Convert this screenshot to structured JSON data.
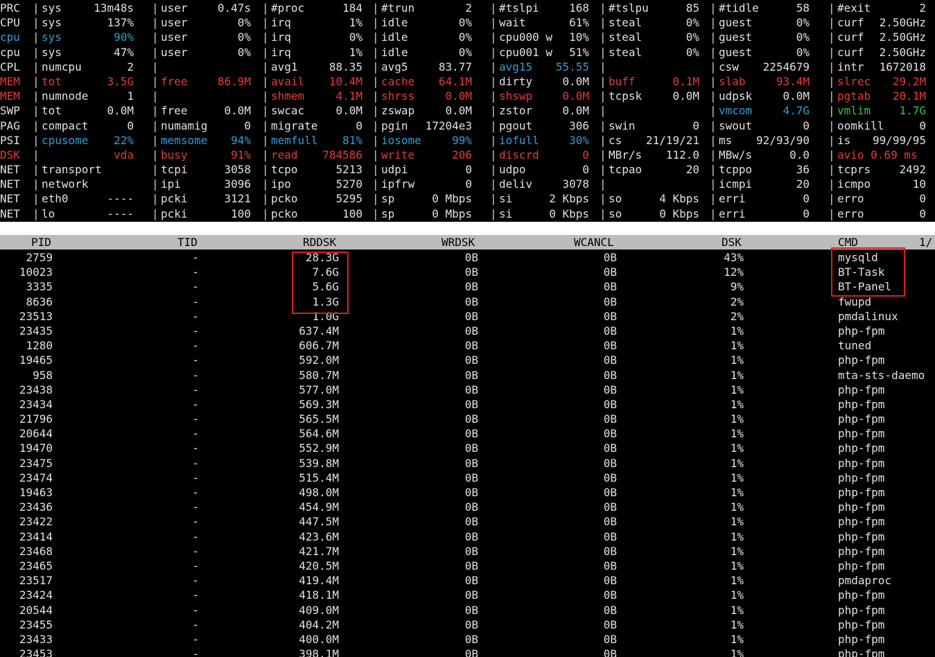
{
  "colors": {
    "white": "#e2e2e2",
    "red": "#e8393c",
    "blue": "#2e9fd6",
    "green": "#3ec43e",
    "header_bg": "#bcbcbc",
    "highlight_box": "#e11b1b"
  },
  "system_rows": [
    {
      "label": "PRC",
      "color": "white",
      "cells": [
        {
          "k": "sys",
          "v": "13m48s"
        },
        {
          "k": "user",
          "v": "0.47s"
        },
        {
          "k": "#proc",
          "v": "184"
        },
        {
          "k": "#trun",
          "v": "2"
        },
        {
          "k": "#tslpi",
          "v": "168"
        },
        {
          "k": "#tslpu",
          "v": "85"
        },
        {
          "k": "#tidle",
          "v": "58"
        },
        {
          "k": "#exit",
          "v": "2"
        }
      ]
    },
    {
      "label": "CPU",
      "color": "white",
      "cells": [
        {
          "k": "sys",
          "v": "137%"
        },
        {
          "k": "user",
          "v": "0%"
        },
        {
          "k": "irq",
          "v": "1%"
        },
        {
          "k": "idle",
          "v": "0%"
        },
        {
          "k": "wait",
          "v": "61%"
        },
        {
          "k": "steal",
          "v": "0%"
        },
        {
          "k": "guest",
          "v": "0%"
        },
        {
          "k": "curf",
          "v": "2.50GHz"
        }
      ]
    },
    {
      "label": "cpu",
      "color": "blue",
      "cells": [
        {
          "k": "sys",
          "v": "90%",
          "c": "blue"
        },
        {
          "k": "user",
          "v": "0%"
        },
        {
          "k": "irq",
          "v": "0%"
        },
        {
          "k": "idle",
          "v": "0%"
        },
        {
          "k": "cpu000 w",
          "v": "10%"
        },
        {
          "k": "steal",
          "v": "0%"
        },
        {
          "k": "guest",
          "v": "0%"
        },
        {
          "k": "curf",
          "v": "2.50GHz"
        }
      ]
    },
    {
      "label": "cpu",
      "color": "white",
      "cells": [
        {
          "k": "sys",
          "v": "47%"
        },
        {
          "k": "user",
          "v": "0%"
        },
        {
          "k": "irq",
          "v": "1%"
        },
        {
          "k": "idle",
          "v": "0%"
        },
        {
          "k": "cpu001 w",
          "v": "51%"
        },
        {
          "k": "steal",
          "v": "0%"
        },
        {
          "k": "guest",
          "v": "0%"
        },
        {
          "k": "curf",
          "v": "2.50GHz"
        }
      ]
    },
    {
      "label": "CPL",
      "color": "white",
      "cells": [
        {
          "k": "numcpu",
          "v": "2"
        },
        {
          "k": "",
          "v": ""
        },
        {
          "k": "avg1",
          "v": "88.35"
        },
        {
          "k": "avg5",
          "v": "83.77"
        },
        {
          "k": "avg15",
          "v": "55.55",
          "c": "blue"
        },
        {
          "k": "",
          "v": ""
        },
        {
          "k": "csw",
          "v": "2254679"
        },
        {
          "k": "intr",
          "v": "1672018"
        }
      ]
    },
    {
      "label": "MEM",
      "color": "red",
      "cells": [
        {
          "k": "tot",
          "v": "3.5G",
          "c": "red"
        },
        {
          "k": "free",
          "v": "86.9M",
          "c": "red"
        },
        {
          "k": "avail",
          "v": "10.4M",
          "c": "red"
        },
        {
          "k": "cache",
          "v": "64.1M",
          "c": "red"
        },
        {
          "k": "dirty",
          "v": "0.0M"
        },
        {
          "k": "buff",
          "v": "0.1M",
          "c": "red"
        },
        {
          "k": "slab",
          "v": "93.4M",
          "c": "red"
        },
        {
          "k": "slrec",
          "v": "29.2M",
          "c": "red"
        }
      ]
    },
    {
      "label": "MEM",
      "color": "red",
      "cells": [
        {
          "k": "numnode",
          "v": "1"
        },
        {
          "k": "",
          "v": ""
        },
        {
          "k": "shmem",
          "v": "4.1M",
          "c": "red"
        },
        {
          "k": "shrss",
          "v": "0.0M",
          "c": "red"
        },
        {
          "k": "shswp",
          "v": "0.0M",
          "c": "red"
        },
        {
          "k": "tcpsk",
          "v": "0.0M"
        },
        {
          "k": "udpsk",
          "v": "0.0M"
        },
        {
          "k": "pgtab",
          "v": "20.1M",
          "c": "red"
        }
      ]
    },
    {
      "label": "SWP",
      "color": "white",
      "cells": [
        {
          "k": "tot",
          "v": "0.0M"
        },
        {
          "k": "free",
          "v": "0.0M"
        },
        {
          "k": "swcac",
          "v": "0.0M"
        },
        {
          "k": "zswap",
          "v": "0.0M"
        },
        {
          "k": "zstor",
          "v": "0.0M"
        },
        {
          "k": "",
          "v": ""
        },
        {
          "k": "vmcom",
          "v": "4.7G",
          "c": "blue"
        },
        {
          "k": "vmlim",
          "v": "1.7G",
          "c": "green"
        }
      ]
    },
    {
      "label": "PAG",
      "color": "white",
      "cells": [
        {
          "k": "compact",
          "v": "0"
        },
        {
          "k": "numamig",
          "v": "0"
        },
        {
          "k": "migrate",
          "v": "0"
        },
        {
          "k": "pgin",
          "v": "17204e3"
        },
        {
          "k": "pgout",
          "v": "306"
        },
        {
          "k": "swin",
          "v": "0"
        },
        {
          "k": "swout",
          "v": "0"
        },
        {
          "k": "oomkill",
          "v": "0"
        }
      ]
    },
    {
      "label": "PSI",
      "color": "white",
      "cells": [
        {
          "k": "cpusome",
          "v": "22%",
          "c": "blue"
        },
        {
          "k": "memsome",
          "v": "94%",
          "c": "blue"
        },
        {
          "k": "memfull",
          "v": "81%",
          "c": "blue"
        },
        {
          "k": "iosome",
          "v": "99%",
          "c": "blue"
        },
        {
          "k": "iofull",
          "v": "30%",
          "c": "blue"
        },
        {
          "k": "cs",
          "v": "21/19/21"
        },
        {
          "k": "ms",
          "v": "92/93/90"
        },
        {
          "k": "is",
          "v": "99/99/95"
        }
      ]
    },
    {
      "label": "DSK",
      "color": "red",
      "cells": [
        {
          "k": "",
          "v": "vda",
          "c": "red"
        },
        {
          "k": "busy",
          "v": "91%",
          "c": "red"
        },
        {
          "k": "read",
          "v": "784586",
          "c": "red"
        },
        {
          "k": "write",
          "v": "206",
          "c": "red"
        },
        {
          "k": "discrd",
          "v": "0",
          "c": "red"
        },
        {
          "k": "MBr/s",
          "v": "112.0"
        },
        {
          "k": "MBw/s",
          "v": "0.0"
        },
        {
          "k": "avio 0.69 ms",
          "v": "",
          "c": "red"
        }
      ]
    },
    {
      "label": "NET",
      "color": "white",
      "cells": [
        {
          "k": "transport",
          "v": ""
        },
        {
          "k": "tcpi",
          "v": "3058"
        },
        {
          "k": "tcpo",
          "v": "5213"
        },
        {
          "k": "udpi",
          "v": "0"
        },
        {
          "k": "udpo",
          "v": "0"
        },
        {
          "k": "tcpao",
          "v": "20"
        },
        {
          "k": "tcppo",
          "v": "36"
        },
        {
          "k": "tcprs",
          "v": "2492"
        }
      ]
    },
    {
      "label": "NET",
      "color": "white",
      "cells": [
        {
          "k": "network",
          "v": ""
        },
        {
          "k": "ipi",
          "v": "3096"
        },
        {
          "k": "ipo",
          "v": "5270"
        },
        {
          "k": "ipfrw",
          "v": "0"
        },
        {
          "k": "deliv",
          "v": "3078"
        },
        {
          "k": "",
          "v": ""
        },
        {
          "k": "icmpi",
          "v": "20"
        },
        {
          "k": "icmpo",
          "v": "10"
        }
      ]
    },
    {
      "label": "NET",
      "color": "white",
      "cells": [
        {
          "k": "eth0",
          "v": "----"
        },
        {
          "k": "pcki",
          "v": "3121"
        },
        {
          "k": "pcko",
          "v": "5295"
        },
        {
          "k": "sp",
          "v": "0 Mbps"
        },
        {
          "k": "si",
          "v": "2 Kbps"
        },
        {
          "k": "so",
          "v": "4 Kbps"
        },
        {
          "k": "erri",
          "v": "0"
        },
        {
          "k": "erro",
          "v": "0"
        }
      ]
    },
    {
      "label": "NET",
      "color": "white",
      "cells": [
        {
          "k": "lo",
          "v": "----"
        },
        {
          "k": "pcki",
          "v": "100"
        },
        {
          "k": "pcko",
          "v": "100"
        },
        {
          "k": "sp",
          "v": "0 Mbps"
        },
        {
          "k": "si",
          "v": "0 Kbps"
        },
        {
          "k": "so",
          "v": "0 Kbps"
        },
        {
          "k": "erri",
          "v": "0"
        },
        {
          "k": "erro",
          "v": "0"
        }
      ]
    }
  ],
  "process_header": {
    "pid": "PID",
    "tid": "TID",
    "rddsk": "RDDSK",
    "wrdsk": "WRDSK",
    "wcancl": "WCANCL",
    "dsk": "DSK",
    "cmd": "CMD",
    "page": "1/"
  },
  "processes": [
    {
      "pid": "2759",
      "tid": "-",
      "rddsk": "28.3G",
      "wrdsk": "0B",
      "wcancl": "0B",
      "dsk": "43%",
      "cmd": "mysqld"
    },
    {
      "pid": "10023",
      "tid": "-",
      "rddsk": "7.6G",
      "wrdsk": "0B",
      "wcancl": "0B",
      "dsk": "12%",
      "cmd": "BT-Task"
    },
    {
      "pid": "3335",
      "tid": "-",
      "rddsk": "5.6G",
      "wrdsk": "0B",
      "wcancl": "0B",
      "dsk": "9%",
      "cmd": "BT-Panel"
    },
    {
      "pid": "8636",
      "tid": "-",
      "rddsk": "1.3G",
      "wrdsk": "0B",
      "wcancl": "0B",
      "dsk": "2%",
      "cmd": "fwupd"
    },
    {
      "pid": "23513",
      "tid": "-",
      "rddsk": "1.0G",
      "wrdsk": "0B",
      "wcancl": "0B",
      "dsk": "2%",
      "cmd": "pmdalinux"
    },
    {
      "pid": "23435",
      "tid": "-",
      "rddsk": "637.4M",
      "wrdsk": "0B",
      "wcancl": "0B",
      "dsk": "1%",
      "cmd": "php-fpm"
    },
    {
      "pid": "1280",
      "tid": "-",
      "rddsk": "606.7M",
      "wrdsk": "0B",
      "wcancl": "0B",
      "dsk": "1%",
      "cmd": "tuned"
    },
    {
      "pid": "19465",
      "tid": "-",
      "rddsk": "592.0M",
      "wrdsk": "0B",
      "wcancl": "0B",
      "dsk": "1%",
      "cmd": "php-fpm"
    },
    {
      "pid": "958",
      "tid": "-",
      "rddsk": "580.7M",
      "wrdsk": "0B",
      "wcancl": "0B",
      "dsk": "1%",
      "cmd": "mta-sts-daemo"
    },
    {
      "pid": "23438",
      "tid": "-",
      "rddsk": "577.0M",
      "wrdsk": "0B",
      "wcancl": "0B",
      "dsk": "1%",
      "cmd": "php-fpm"
    },
    {
      "pid": "23434",
      "tid": "-",
      "rddsk": "569.3M",
      "wrdsk": "0B",
      "wcancl": "0B",
      "dsk": "1%",
      "cmd": "php-fpm"
    },
    {
      "pid": "21796",
      "tid": "-",
      "rddsk": "565.5M",
      "wrdsk": "0B",
      "wcancl": "0B",
      "dsk": "1%",
      "cmd": "php-fpm"
    },
    {
      "pid": "20644",
      "tid": "-",
      "rddsk": "564.6M",
      "wrdsk": "0B",
      "wcancl": "0B",
      "dsk": "1%",
      "cmd": "php-fpm"
    },
    {
      "pid": "19470",
      "tid": "-",
      "rddsk": "552.9M",
      "wrdsk": "0B",
      "wcancl": "0B",
      "dsk": "1%",
      "cmd": "php-fpm"
    },
    {
      "pid": "23475",
      "tid": "-",
      "rddsk": "539.8M",
      "wrdsk": "0B",
      "wcancl": "0B",
      "dsk": "1%",
      "cmd": "php-fpm"
    },
    {
      "pid": "23474",
      "tid": "-",
      "rddsk": "515.4M",
      "wrdsk": "0B",
      "wcancl": "0B",
      "dsk": "1%",
      "cmd": "php-fpm"
    },
    {
      "pid": "19463",
      "tid": "-",
      "rddsk": "498.0M",
      "wrdsk": "0B",
      "wcancl": "0B",
      "dsk": "1%",
      "cmd": "php-fpm"
    },
    {
      "pid": "23436",
      "tid": "-",
      "rddsk": "454.9M",
      "wrdsk": "0B",
      "wcancl": "0B",
      "dsk": "1%",
      "cmd": "php-fpm"
    },
    {
      "pid": "23422",
      "tid": "-",
      "rddsk": "447.5M",
      "wrdsk": "0B",
      "wcancl": "0B",
      "dsk": "1%",
      "cmd": "php-fpm"
    },
    {
      "pid": "23414",
      "tid": "-",
      "rddsk": "423.6M",
      "wrdsk": "0B",
      "wcancl": "0B",
      "dsk": "1%",
      "cmd": "php-fpm"
    },
    {
      "pid": "23468",
      "tid": "-",
      "rddsk": "421.7M",
      "wrdsk": "0B",
      "wcancl": "0B",
      "dsk": "1%",
      "cmd": "php-fpm"
    },
    {
      "pid": "23465",
      "tid": "-",
      "rddsk": "420.5M",
      "wrdsk": "0B",
      "wcancl": "0B",
      "dsk": "1%",
      "cmd": "php-fpm"
    },
    {
      "pid": "23517",
      "tid": "-",
      "rddsk": "419.4M",
      "wrdsk": "0B",
      "wcancl": "0B",
      "dsk": "1%",
      "cmd": "pmdaproc"
    },
    {
      "pid": "23424",
      "tid": "-",
      "rddsk": "418.1M",
      "wrdsk": "0B",
      "wcancl": "0B",
      "dsk": "1%",
      "cmd": "php-fpm"
    },
    {
      "pid": "20544",
      "tid": "-",
      "rddsk": "409.0M",
      "wrdsk": "0B",
      "wcancl": "0B",
      "dsk": "1%",
      "cmd": "php-fpm"
    },
    {
      "pid": "23455",
      "tid": "-",
      "rddsk": "404.2M",
      "wrdsk": "0B",
      "wcancl": "0B",
      "dsk": "1%",
      "cmd": "php-fpm"
    },
    {
      "pid": "23433",
      "tid": "-",
      "rddsk": "400.0M",
      "wrdsk": "0B",
      "wcancl": "0B",
      "dsk": "1%",
      "cmd": "php-fpm"
    },
    {
      "pid": "23453",
      "tid": "-",
      "rddsk": "398.1M",
      "wrdsk": "0B",
      "wcancl": "0B",
      "dsk": "1%",
      "cmd": "php-fpm"
    }
  ]
}
